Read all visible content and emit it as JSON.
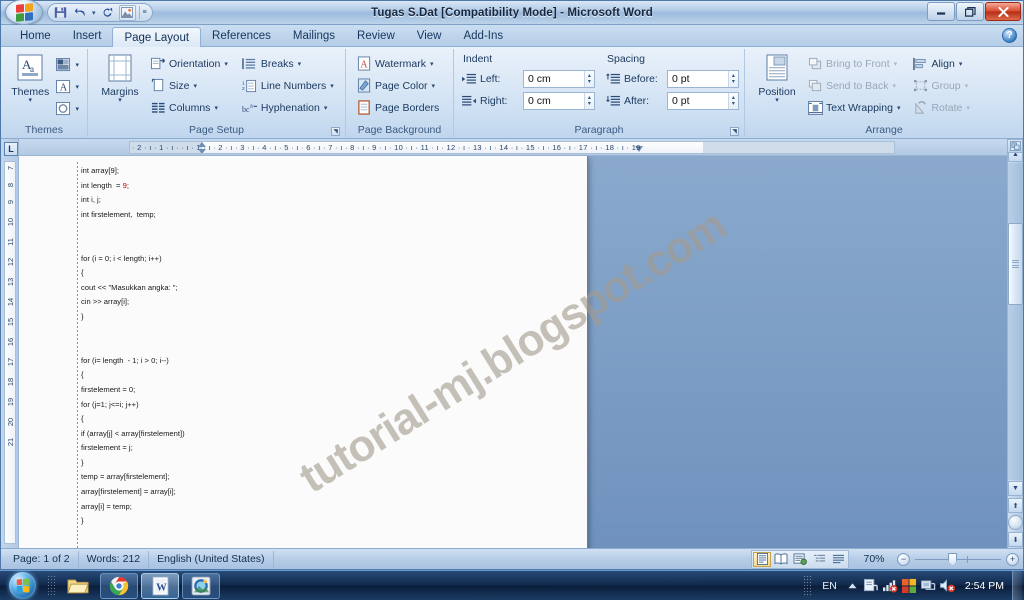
{
  "window": {
    "title": "Tugas S.Dat [Compatibility Mode] - Microsoft Word",
    "minimize_label": "–",
    "restore_label": "❐",
    "close_label": "✕",
    "help_label": "?"
  },
  "quick_access": {
    "save_label": "save-icon",
    "undo_label": "undo-icon",
    "redo_label": "redo-icon",
    "picture_label": "picture-icon",
    "customize_label": "≡"
  },
  "tabs": [
    {
      "label": "Home",
      "active": false
    },
    {
      "label": "Insert",
      "active": false
    },
    {
      "label": "Page Layout",
      "active": true
    },
    {
      "label": "References",
      "active": false
    },
    {
      "label": "Mailings",
      "active": false
    },
    {
      "label": "Review",
      "active": false
    },
    {
      "label": "View",
      "active": false
    },
    {
      "label": "Add-Ins",
      "active": false
    }
  ],
  "ribbon": {
    "groups": [
      {
        "name": "Themes",
        "label": "Themes"
      },
      {
        "name": "Page Setup",
        "label": "Page Setup"
      },
      {
        "name": "Page Background",
        "label": "Page Background"
      },
      {
        "name": "Paragraph",
        "label": "Paragraph"
      },
      {
        "name": "Arrange",
        "label": "Arrange"
      }
    ],
    "themes": {
      "big_label": "Themes",
      "colors_label": "theme-colors-icon",
      "fonts_label": "theme-fonts-icon",
      "effects_label": "theme-effects-icon"
    },
    "page_setup": {
      "margins_label": "Margins",
      "orientation_label": "Orientation",
      "size_label": "Size",
      "columns_label": "Columns",
      "breaks_label": "Breaks",
      "line_numbers_label": "Line Numbers",
      "hyphenation_label": "Hyphenation"
    },
    "page_background": {
      "watermark_label": "Watermark",
      "page_color_label": "Page Color",
      "page_borders_label": "Page Borders"
    },
    "paragraph": {
      "indent_heading": "Indent",
      "spacing_heading": "Spacing",
      "indent_left_label": "Left:",
      "indent_left_value": "0 cm",
      "indent_right_label": "Right:",
      "indent_right_value": "0 cm",
      "spacing_before_label": "Before:",
      "spacing_before_value": "0 pt",
      "spacing_after_label": "After:",
      "spacing_after_value": "0 pt"
    },
    "arrange": {
      "position_label": "Position",
      "bring_to_front_label": "Bring to Front",
      "send_to_back_label": "Send to Back",
      "text_wrapping_label": "Text Wrapping",
      "align_label": "Align",
      "group_label": "Group",
      "rotate_label": "Rotate"
    }
  },
  "rulers": {
    "tab_stop_label": "L",
    "horizontal_ticks": "· 2 · ı · 1 · ı ·    · ı · 1 · ı · 2 · ı · 3 · ı · 4 · ı · 5 · ı · 6 · ı · 7 · ı · 8 · ı · 9 · ı · 10 · ı · 11 · ı · 12 · ı · 13 · ı · 14 · ı · 15 · ı · 16 · ı · 17 · ı · 18 · ı · 19",
    "vertical_ticks": [
      "7",
      "8",
      "9",
      "10",
      "11",
      "12",
      "13",
      "14",
      "15",
      "16",
      "17",
      "18",
      "19",
      "20",
      "21"
    ]
  },
  "document": {
    "watermark": "tutorial-mj.blogspot.com",
    "lines": [
      {
        "text": "int array[9];"
      },
      {
        "text": "int length  = ",
        "num": "9",
        "tail": ";"
      },
      {
        "text": "int i, j;"
      },
      {
        "text": "int firstelement,  temp;"
      },
      {
        "text": ""
      },
      {
        "text": ""
      },
      {
        "text": "for (i = 0; i < length; i++)"
      },
      {
        "text": "{"
      },
      {
        "text": "cout << \"Masukkan angka: \";"
      },
      {
        "text": "cin >> array[i];"
      },
      {
        "text": "}"
      },
      {
        "text": ""
      },
      {
        "text": ""
      },
      {
        "text": "for (i= length  - 1; i > 0; i--)"
      },
      {
        "text": "{"
      },
      {
        "text": "firstelement = 0;"
      },
      {
        "text": "for (j=1; j<=i; j++)"
      },
      {
        "text": "{"
      },
      {
        "text": "if (array[j] < array[firstelement])"
      },
      {
        "text": "firstelement = j;"
      },
      {
        "text": "}"
      },
      {
        "text": "temp = array[firstelement];"
      },
      {
        "text": "array[firstelement] = array[i];"
      },
      {
        "text": "array[i] = temp;"
      },
      {
        "text": "}"
      }
    ]
  },
  "status_bar": {
    "page_info": "Page: 1 of 2",
    "word_count": "Words: 212",
    "language": "English (United States)",
    "zoom_level": "70%",
    "zoom_out_label": "−",
    "zoom_in_label": "+",
    "views": [
      {
        "name": "print-layout",
        "active": true
      },
      {
        "name": "full-screen-reading",
        "active": false
      },
      {
        "name": "web-layout",
        "active": false
      },
      {
        "name": "outline",
        "active": false
      },
      {
        "name": "draft",
        "active": false
      }
    ]
  },
  "taskbar": {
    "start_label": "start-orb",
    "items": [
      {
        "name": "explorer",
        "label": "folder-icon",
        "state": "running"
      },
      {
        "name": "chrome",
        "label": "chrome-icon",
        "state": "running"
      },
      {
        "name": "word",
        "label": "word-icon",
        "state": "active"
      },
      {
        "name": "media",
        "label": "media-icon",
        "state": "running"
      }
    ],
    "tray": {
      "language": "EN",
      "show_hidden_label": "▲",
      "clock": "2:54 PM"
    }
  }
}
